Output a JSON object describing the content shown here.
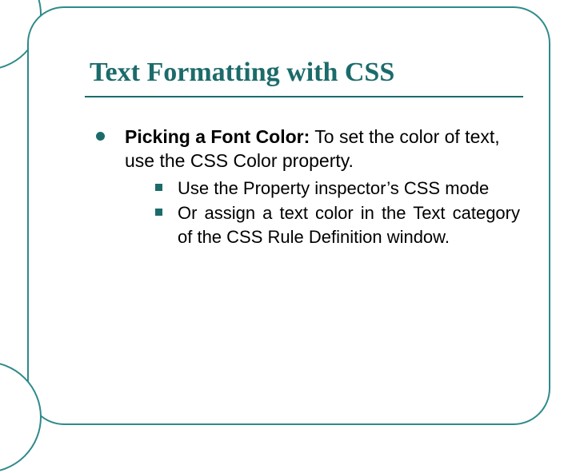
{
  "title": "Text Formatting with CSS",
  "bullet": {
    "lead": "Picking a Font Color:",
    "rest": " To set the color of text, use the CSS Color property.",
    "subs": [
      "Use the Property inspector’s CSS mode",
      "Or assign a text color in the Text category of the CSS Rule Definition window."
    ]
  },
  "colors": {
    "accent": "#1c6b6b",
    "border": "#2f8a8a"
  }
}
